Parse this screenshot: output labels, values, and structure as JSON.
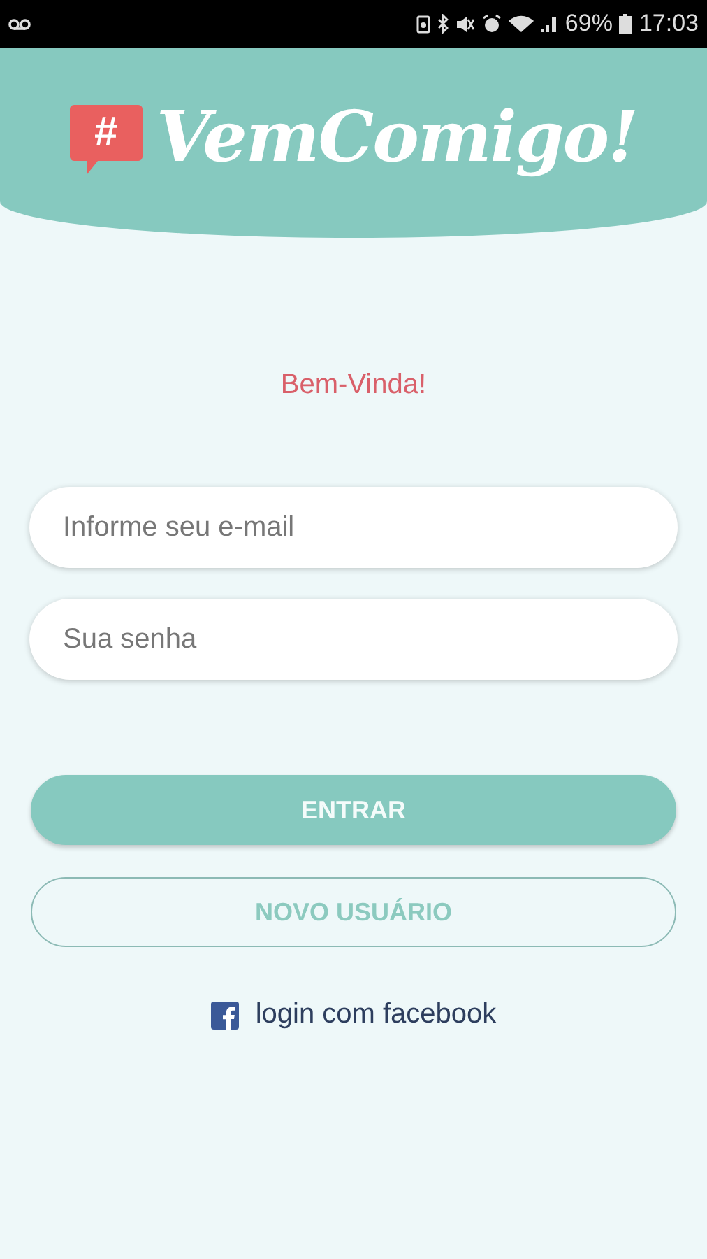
{
  "status_bar": {
    "battery": "69%",
    "time": "17:03"
  },
  "header": {
    "logo_badge": "#",
    "logo_title": "VemComigo!"
  },
  "greeting": "Bem-Vinda!",
  "fields": [
    {
      "placeholder": "Informe seu e-mail"
    },
    {
      "placeholder": "Sua senha"
    }
  ],
  "buttons": [
    {
      "label": "ENTRAR",
      "kind": "primary"
    },
    {
      "label": "NOVO USUÁRIO",
      "kind": "outline"
    }
  ],
  "facebook_link": "login com facebook"
}
